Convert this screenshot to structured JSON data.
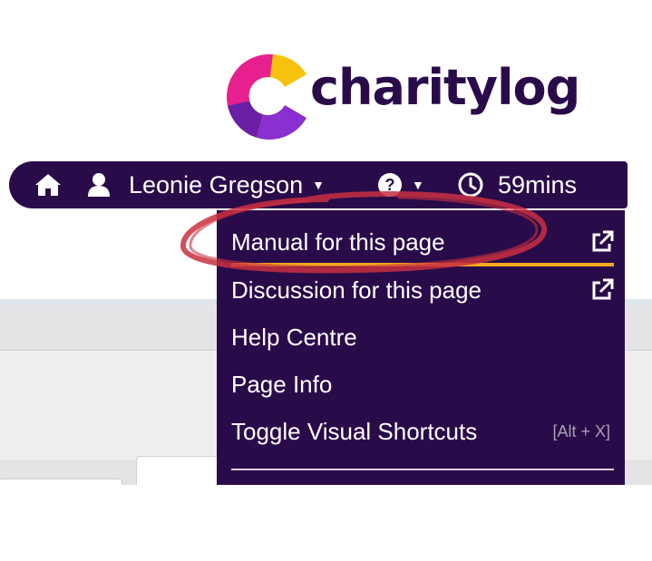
{
  "logo": {
    "text": "charitylog"
  },
  "navbar": {
    "home_icon": "home-icon",
    "user_icon": "user-icon",
    "user_name": "Leonie Gregson",
    "help_icon": "question-circle-icon",
    "clock_icon": "clock-icon",
    "session_time": "59mins"
  },
  "help_menu": {
    "items": [
      {
        "label": "Manual for this page",
        "icon": "external-link-icon"
      },
      {
        "label": "Discussion for this page",
        "icon": "external-link-icon"
      },
      {
        "label": "Help Centre"
      },
      {
        "label": "Page Info"
      },
      {
        "label": "Toggle Visual Shortcuts",
        "shortcut": "[Alt + X]"
      }
    ]
  },
  "colors": {
    "brand_purple": "#2a0b4a",
    "accent_orange": "#f2a81d",
    "annotation_red": "#c9303f"
  }
}
